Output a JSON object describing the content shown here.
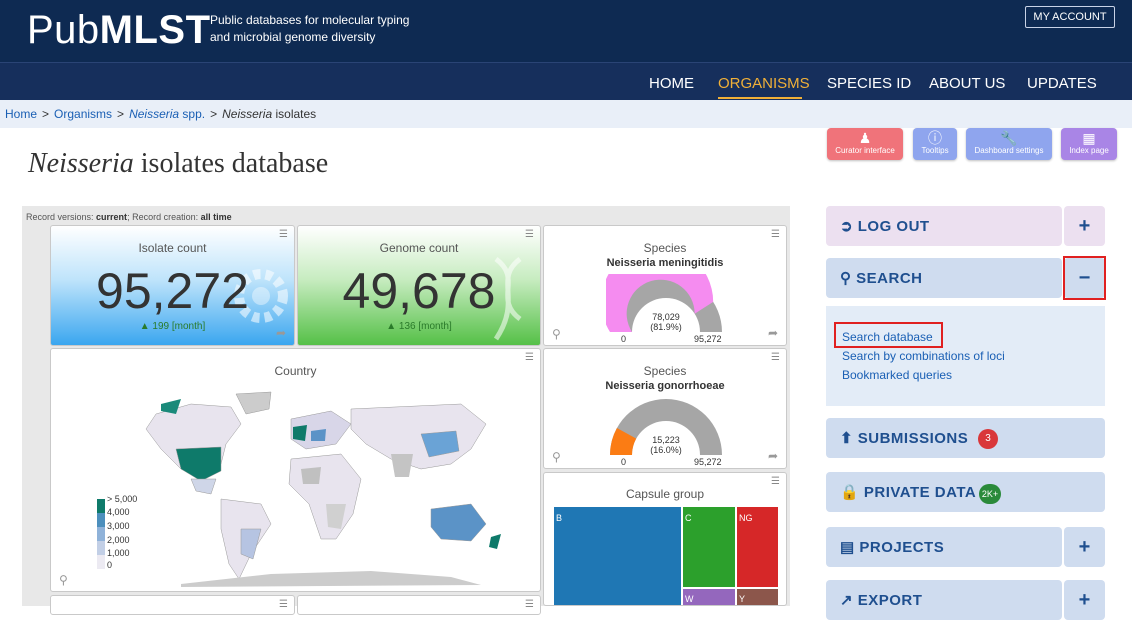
{
  "header": {
    "logo_pre": "Pub",
    "logo_bold": "MLST",
    "tagline_line1": "Public databases for molecular typing",
    "tagline_line2": "and microbial genome diversity",
    "account_label": "MY ACCOUNT"
  },
  "nav": {
    "items": [
      "HOME",
      "ORGANISMS",
      "SPECIES ID",
      "ABOUT US",
      "UPDATES"
    ],
    "active": "ORGANISMS"
  },
  "breadcrumb": {
    "home": "Home",
    "organisms": "Organisms",
    "genus": "Neisseria",
    "genus_suffix": "spp.",
    "current_genus": "Neisseria",
    "current_suffix": "isolates"
  },
  "page": {
    "title_genus": "Neisseria",
    "title_rest": "isolates database"
  },
  "toolbar": {
    "curator_label": "Curator interface",
    "tooltips_label": "Tooltips",
    "dashboard_label": "Dashboard settings",
    "index_label": "Index page"
  },
  "dashboard": {
    "record_versions_label": "Record versions:",
    "record_versions_value": "current",
    "record_creation_label": "; Record creation:",
    "record_creation_value": "all time",
    "isolate_count": {
      "title": "Isolate count",
      "value": "95,272",
      "delta": "▲ 199 [month]"
    },
    "genome_count": {
      "title": "Genome count",
      "value": "49,678",
      "delta": "▲ 136 [month]"
    },
    "species_1": {
      "title": "Species",
      "subtitle": "Neisseria meningitidis",
      "count": "78,029",
      "percent": "(81.9%)",
      "min": "0",
      "max": "95,272",
      "fraction": 0.819,
      "color": "#f58cf0"
    },
    "species_2": {
      "title": "Species",
      "subtitle": "Neisseria gonorrhoeae",
      "count": "15,223",
      "percent": "(16.0%)",
      "min": "0",
      "max": "95,272",
      "fraction": 0.16,
      "color": "#fb7c14"
    },
    "country": {
      "title": "Country",
      "legend": [
        "> 5,000",
        "4,000",
        "3,000",
        "2,000",
        "1,000",
        "0"
      ]
    },
    "capsule": {
      "title": "Capsule group",
      "cells": [
        {
          "label": "B",
          "color": "#1f77b4"
        },
        {
          "label": "C",
          "color": "#2ca02c"
        },
        {
          "label": "NG",
          "color": "#d62728"
        },
        {
          "label": "W",
          "color": "#9467bd"
        },
        {
          "label": "Y",
          "color": "#8c564b"
        }
      ]
    }
  },
  "sidebar": {
    "logout": "LOG OUT",
    "search": "SEARCH",
    "search_links": [
      "Search database",
      "Search by combinations of loci",
      "Bookmarked queries"
    ],
    "submissions": "SUBMISSIONS",
    "submissions_badge": "3",
    "private_data": "PRIVATE DATA",
    "private_badge": "2K+",
    "projects": "PROJECTS",
    "export": "EXPORT",
    "plus": "+",
    "minus": "−"
  }
}
